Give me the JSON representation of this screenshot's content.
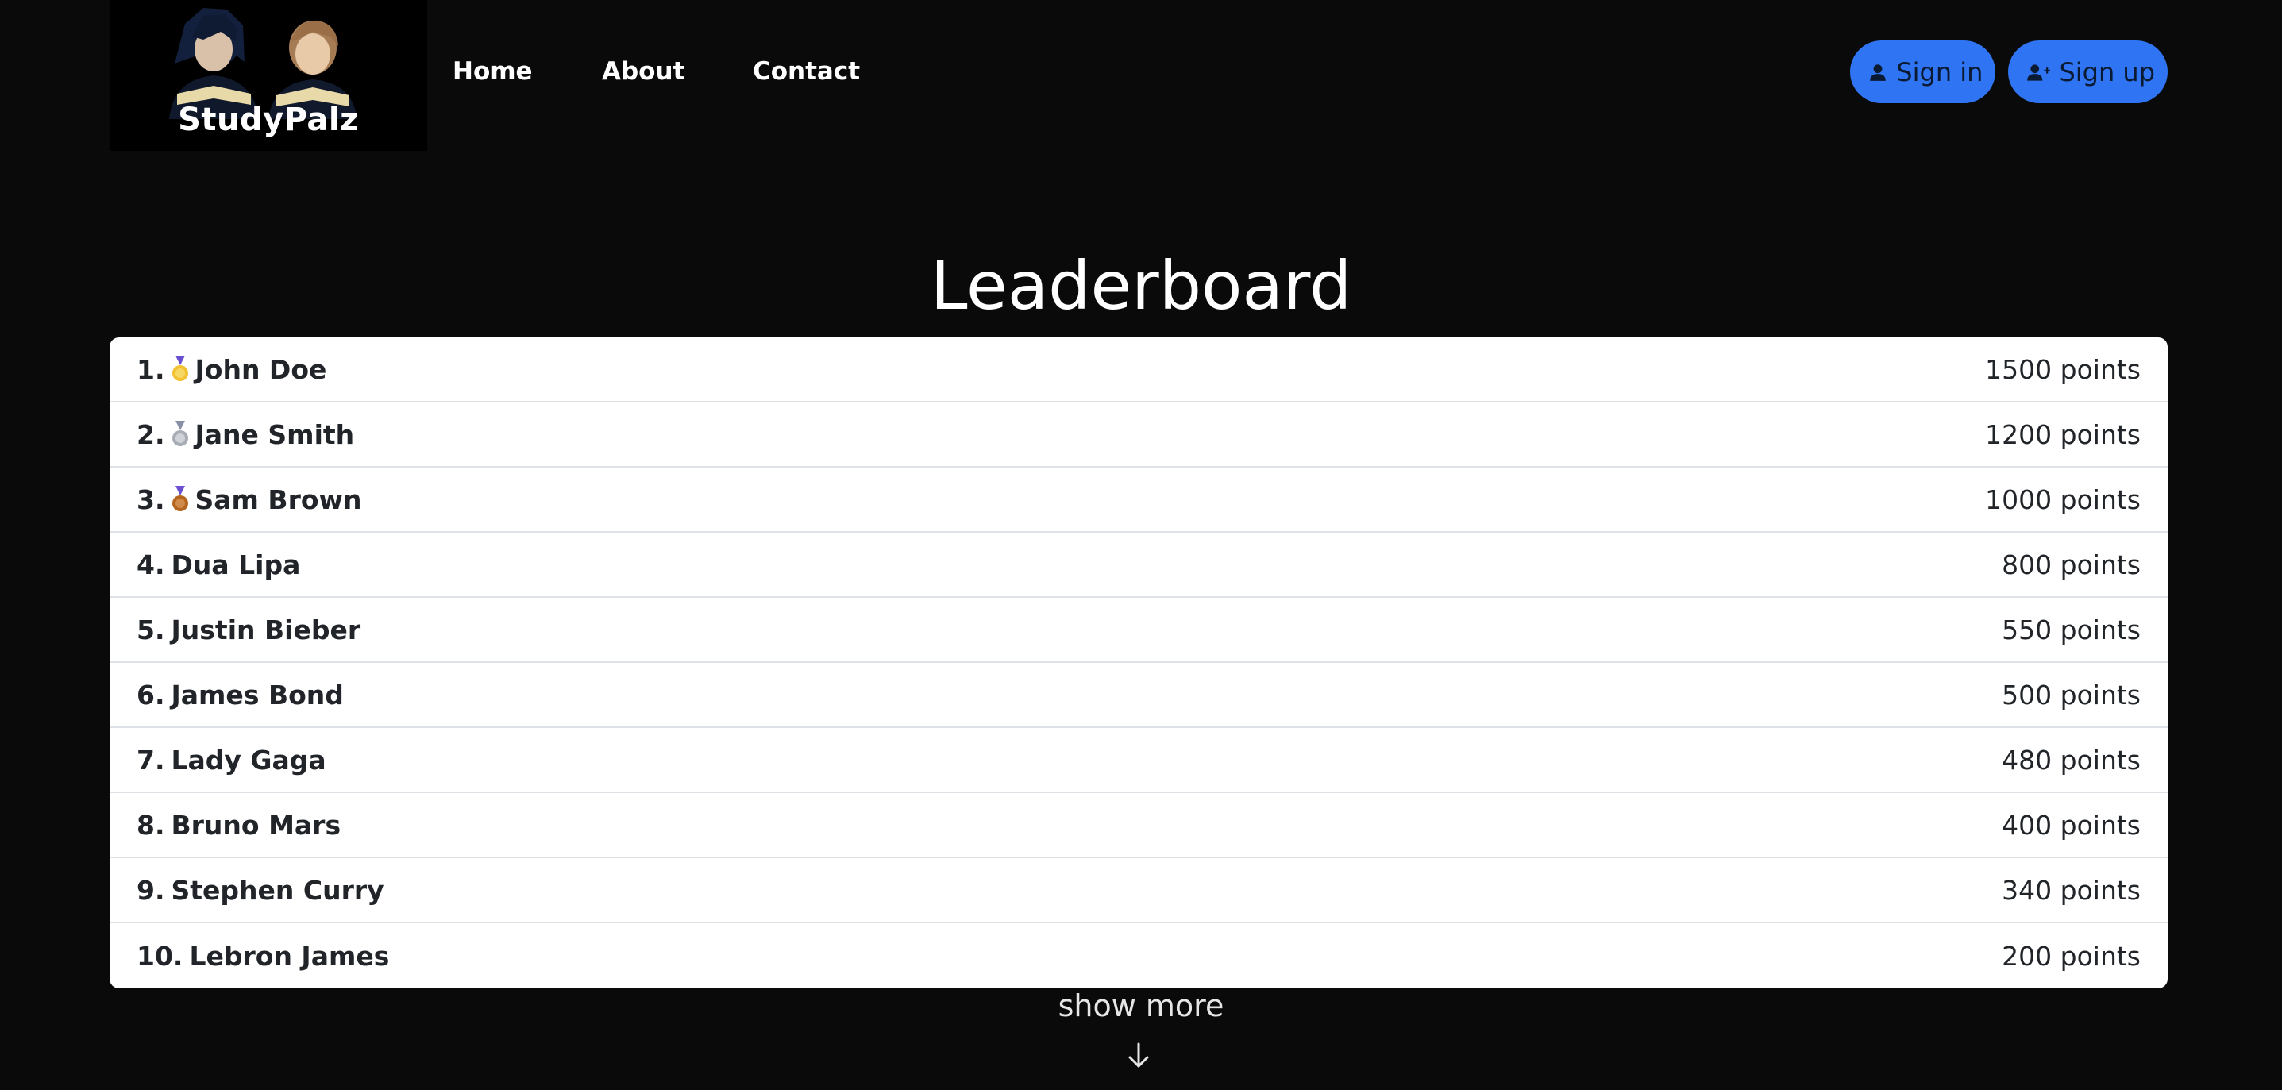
{
  "header": {
    "logo_text": "StudyPalz",
    "nav": [
      {
        "label": "Home"
      },
      {
        "label": "About"
      },
      {
        "label": "Contact"
      }
    ],
    "sign_in_label": "Sign in",
    "sign_up_label": "Sign up"
  },
  "page": {
    "title": "Leaderboard"
  },
  "leaderboard": [
    {
      "rank": "1.",
      "name": "John Doe",
      "points": "1500 points",
      "medal": "gold-medal-icon"
    },
    {
      "rank": "2.",
      "name": "Jane Smith",
      "points": "1200 points",
      "medal": "silver-medal-icon"
    },
    {
      "rank": "3.",
      "name": "Sam Brown",
      "points": "1000 points",
      "medal": "bronze-medal-icon"
    },
    {
      "rank": "4.",
      "name": "Dua Lipa",
      "points": "800 points"
    },
    {
      "rank": "5.",
      "name": "Justin Bieber",
      "points": "550 points"
    },
    {
      "rank": "6.",
      "name": "James Bond",
      "points": "500 points"
    },
    {
      "rank": "7.",
      "name": "Lady Gaga",
      "points": "480 points"
    },
    {
      "rank": "8.",
      "name": "Bruno Mars",
      "points": "400 points"
    },
    {
      "rank": "9.",
      "name": "Stephen Curry",
      "points": "340 points"
    },
    {
      "rank": "10.",
      "name": "Lebron James",
      "points": "200 points"
    }
  ],
  "footer": {
    "show_more_label": "show more",
    "arrow_icon": "arrow-down-icon"
  },
  "colors": {
    "background": "#0a0a0b",
    "accent": "#2f74f2",
    "card": "#ffffff",
    "row_text": "#212529"
  }
}
